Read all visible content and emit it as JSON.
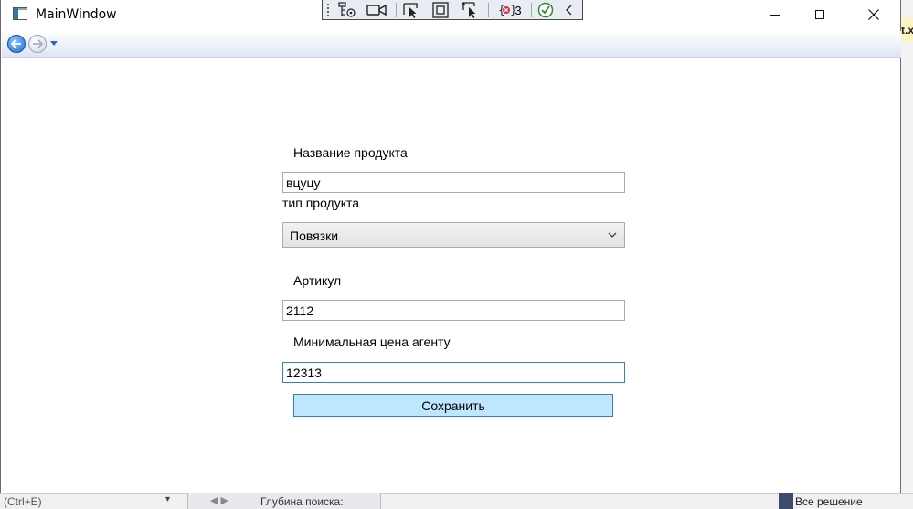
{
  "window": {
    "title": "MainWindow"
  },
  "debug_toolbar": {
    "binding_errors_count": "3"
  },
  "form": {
    "product_name_label": "Название продукта",
    "product_name_value": "вцуцу",
    "product_type_label": "тип продукта",
    "product_type_value": "Повязки",
    "article_label": "Артикул",
    "article_value": "2112",
    "min_price_label": "Минимальная цена агенту",
    "min_price_value": "12313",
    "save_label": "Сохранить"
  },
  "background": {
    "right_tab_text": "t.x",
    "bottom_left_text": "(Ctrl+E)",
    "bottom_mid_text": "Глубина поиска:",
    "bottom_right_text": "Все решение"
  },
  "colors": {
    "button_bg": "#bee6fd",
    "button_border": "#3c7fb1",
    "focused_border": "#3c7fb1"
  }
}
